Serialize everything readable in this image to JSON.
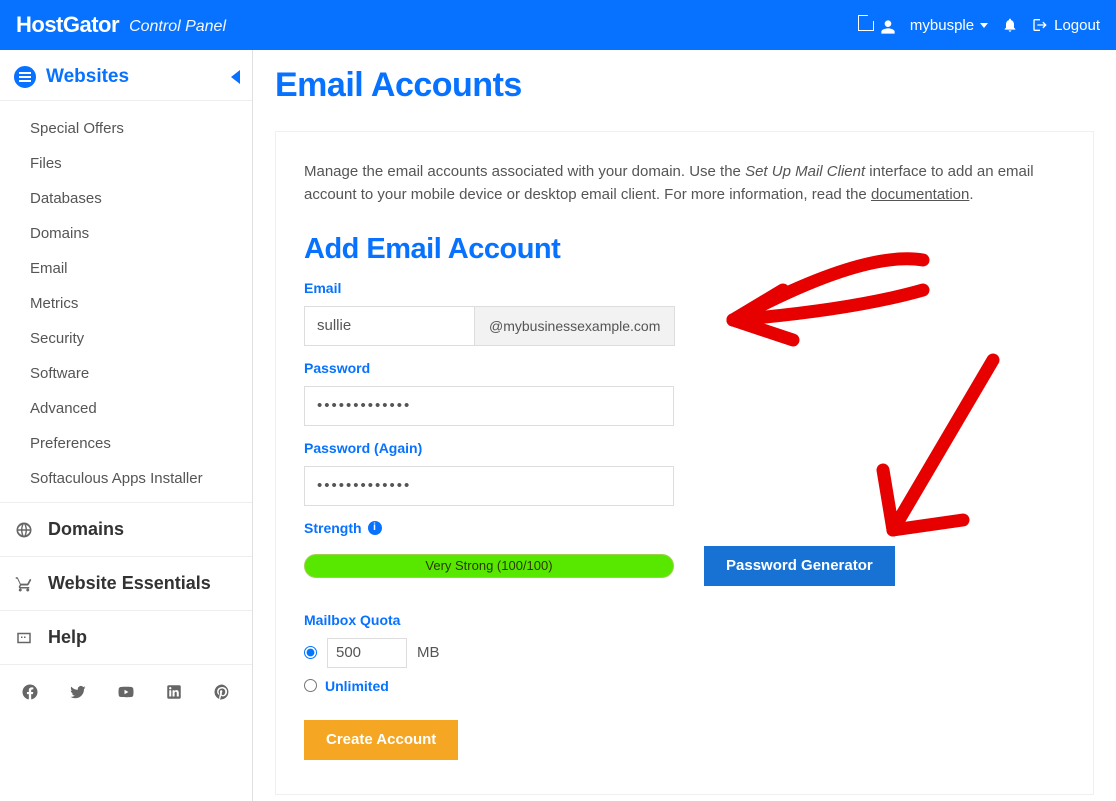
{
  "header": {
    "brand": "HostGator",
    "subtitle": "Control Panel",
    "username": "mybusple",
    "logout": "Logout"
  },
  "sidebar": {
    "active_section": "Websites",
    "items": [
      "Special Offers",
      "Files",
      "Databases",
      "Domains",
      "Email",
      "Metrics",
      "Security",
      "Software",
      "Advanced",
      "Preferences",
      "Softaculous Apps Installer"
    ],
    "sections": [
      "Domains",
      "Website Essentials",
      "Help"
    ]
  },
  "page": {
    "title": "Email Accounts",
    "intro_1": "Manage the email accounts associated with your domain. Use the ",
    "intro_ital": "Set Up Mail Client",
    "intro_2": " interface to add an email account to your mobile device or desktop email client. For more information, read the ",
    "intro_link": "documentation",
    "intro_3": ".",
    "section_title": "Add Email Account",
    "labels": {
      "email": "Email",
      "password": "Password",
      "password_again": "Password (Again)",
      "strength": "Strength",
      "quota": "Mailbox Quota"
    },
    "email_value": "sullie",
    "domain": "@mybusinessexample.com",
    "password_value": "•••••••••••••",
    "password_again_value": "•••••••••••••",
    "strength_text": "Very Strong (100/100)",
    "password_generator_btn": "Password Generator",
    "quota_value": "500",
    "quota_unit": "MB",
    "quota_unlimited": "Unlimited",
    "create_btn": "Create Account"
  }
}
